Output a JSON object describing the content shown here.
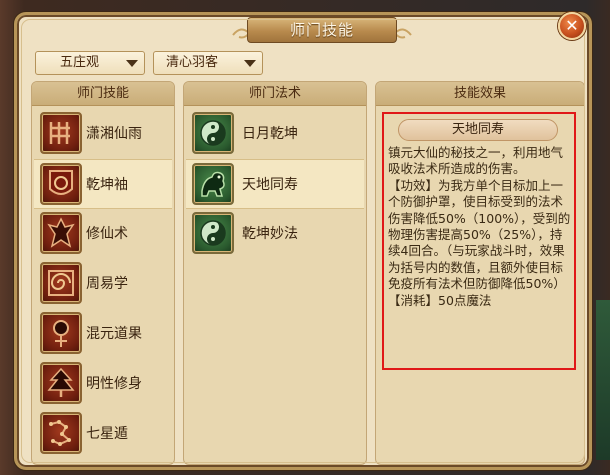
{
  "window": {
    "title": "师门技能",
    "close_label": "✕"
  },
  "filters": {
    "sect": "五庄观",
    "style": "清心羽客"
  },
  "columns": {
    "skills_header": "师门技能",
    "methods_header": "师门法术",
    "effect_header": "技能效果"
  },
  "skills": [
    {
      "label": "潇湘仙雨",
      "icon": "grid-rune-icon",
      "selected": false
    },
    {
      "label": "乾坤袖",
      "icon": "sleeve-shield-icon",
      "selected": true
    },
    {
      "label": "修仙术",
      "icon": "warrior-icon",
      "selected": false
    },
    {
      "label": "周易学",
      "icon": "spiral-scroll-icon",
      "selected": false
    },
    {
      "label": "混元道果",
      "icon": "orb-fruit-icon",
      "selected": false
    },
    {
      "label": "明性修身",
      "icon": "tree-figure-icon",
      "selected": false
    },
    {
      "label": "七星遁",
      "icon": "constellation-icon",
      "selected": false
    }
  ],
  "methods": [
    {
      "label": "日月乾坤",
      "icon": "yinyang-icon",
      "selected": false
    },
    {
      "label": "天地同寿",
      "icon": "beast-icon",
      "selected": true
    },
    {
      "label": "乾坤妙法",
      "icon": "yinyang-icon",
      "selected": false
    }
  ],
  "effect": {
    "name": "天地同寿",
    "lines": [
      "镇元大仙的秘技之一，利用地气吸收法术所造成的伤害。",
      "【功效】为我方单个目标加上一个防御护罩，使目标受到的法术伤害降低50%（100%），受到的物理伤害提高50%（25%），持续4回合。（与玩家战斗时，效果为括号内的数值，且额外使目标免疫所有法术但防御降低50%）",
      "【消耗】50点魔法"
    ]
  },
  "colors": {
    "frame": "#efe1c3",
    "panel": "#e8d7b0",
    "highlight_border": "#e01818",
    "title_gold": "#b88a4d"
  }
}
